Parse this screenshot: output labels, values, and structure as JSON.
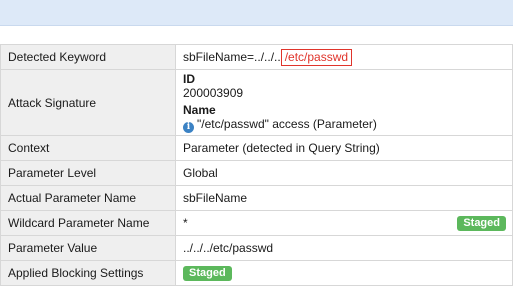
{
  "rows": {
    "detected_keyword": {
      "label": "Detected Keyword",
      "value_prefix": "sbFileName=../../..",
      "value_highlight": "/etc/passwd"
    },
    "attack_signature": {
      "label": "Attack Signature",
      "id_title": "ID",
      "id_value": "200003909",
      "name_title": "Name",
      "name_value": "\"/etc/passwd\" access (Parameter)"
    },
    "context": {
      "label": "Context",
      "value": "Parameter (detected in Query String)"
    },
    "parameter_level": {
      "label": "Parameter Level",
      "value": "Global"
    },
    "actual_parameter_name": {
      "label": "Actual Parameter Name",
      "value": "sbFileName"
    },
    "wildcard_parameter_name": {
      "label": "Wildcard Parameter Name",
      "value": "*",
      "badge": "Staged"
    },
    "parameter_value": {
      "label": "Parameter Value",
      "value": "../../../etc/passwd"
    },
    "applied_blocking_settings": {
      "label": "Applied Blocking Settings",
      "badge": "Staged"
    }
  },
  "icons": {
    "name_info": "info-icon"
  },
  "colors": {
    "highlight": "#e0342b",
    "badge": "#5cb85c",
    "info": "#3b82c4"
  }
}
